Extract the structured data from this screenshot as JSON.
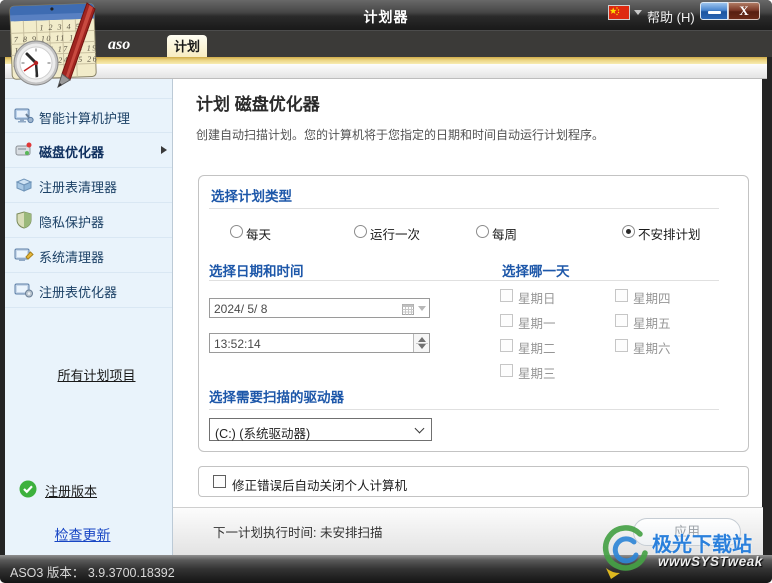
{
  "window": {
    "title": "计划器",
    "help_label": "帮助 (H)",
    "status_label": "ASO3 版本：",
    "status_version": "3.9.3700.18392"
  },
  "tabs": {
    "brand": "aso",
    "active": "计划"
  },
  "sidebar": {
    "items": [
      {
        "label": "智能计算机护理",
        "icon": "pc-care",
        "active": false
      },
      {
        "label": "磁盘优化器",
        "icon": "disk-optimizer",
        "active": true
      },
      {
        "label": "注册表清理器",
        "icon": "registry-cleaner",
        "active": false
      },
      {
        "label": "隐私保护器",
        "icon": "privacy-shield",
        "active": false
      },
      {
        "label": "系统清理器",
        "icon": "system-cleaner",
        "active": false
      },
      {
        "label": "注册表优化器",
        "icon": "registry-optimizer",
        "active": false
      }
    ],
    "all_items_link": "所有计划项目",
    "registered_label": "注册版本",
    "check_updates_link": "检查更新"
  },
  "main": {
    "title": "计划 磁盘优化器",
    "description": "创建自动扫描计划。您的计算机将于您指定的日期和时间自动运行计划程序。",
    "schedule_type": {
      "heading": "选择计划类型",
      "options": [
        {
          "label": "每天",
          "selected": false
        },
        {
          "label": "运行一次",
          "selected": false
        },
        {
          "label": "每周",
          "selected": false
        },
        {
          "label": "不安排计划",
          "selected": true
        }
      ]
    },
    "datetime": {
      "heading": "选择日期和时间",
      "date_value": "2024/ 5/ 8",
      "time_value": "13:52:14"
    },
    "weekday": {
      "heading": "选择哪一天",
      "days": [
        "星期日",
        "星期一",
        "星期二",
        "星期三",
        "星期四",
        "星期五",
        "星期六"
      ],
      "checked": [
        false,
        false,
        false,
        false,
        false,
        false,
        false
      ]
    },
    "drive": {
      "heading": "选择需要扫描的驱动器",
      "selected_option": "(C:) (系统驱动器)"
    },
    "shutdown_label": "修正错误后自动关闭个人计算机",
    "next_run_text": "下一计划执行时间: 未安排扫描",
    "apply_label": "应用"
  },
  "watermark": {
    "site_name": "极光下载站",
    "brand_prefix": "www",
    "brand_name": "SYSTweak"
  },
  "colors": {
    "accent_blue_heading": "#1d57a9",
    "gold_band": "#ecd584",
    "sidebar_bg": "#e9f3fb",
    "link_blue": "#1846c4",
    "watermark_blue": "#2a80dc"
  }
}
